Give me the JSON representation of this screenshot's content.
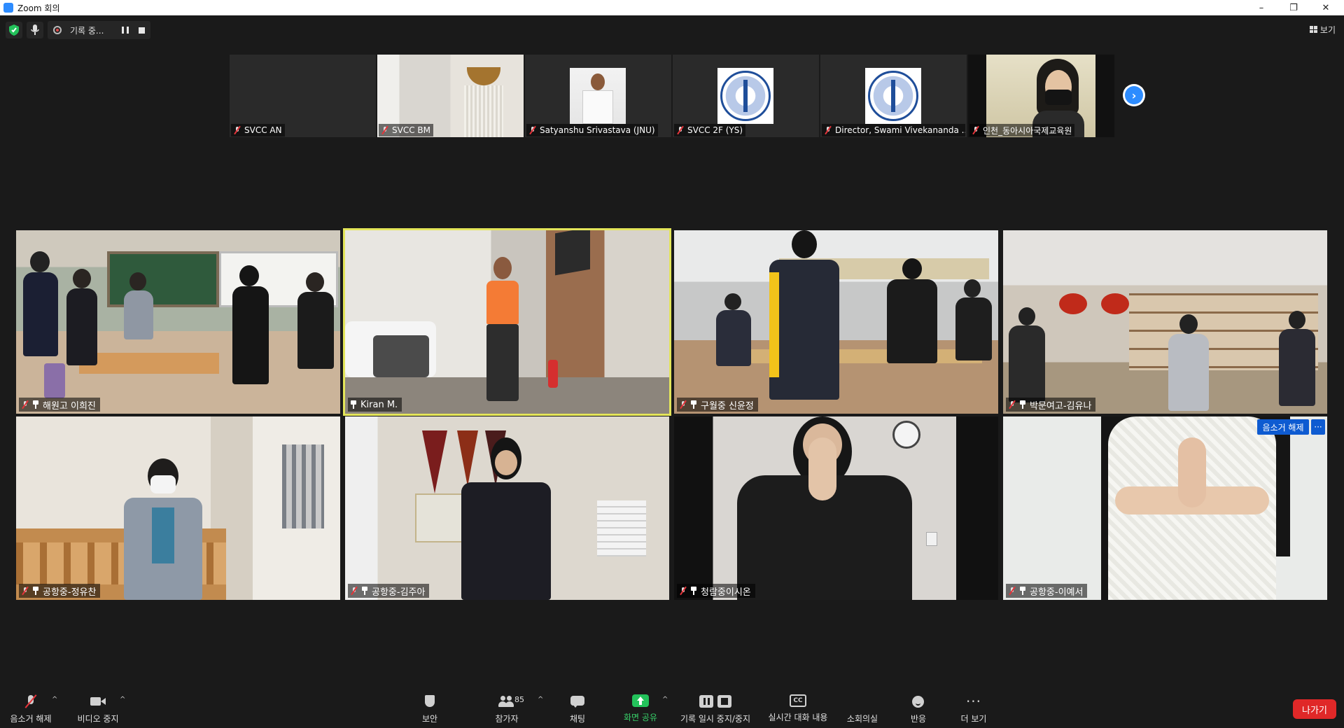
{
  "window": {
    "title": "Zoom 회의",
    "controls": {
      "minimize": "–",
      "maximize": "❐",
      "close": "✕"
    }
  },
  "status": {
    "recording_label": "기록 중...",
    "view_label": "보기"
  },
  "strip": [
    {
      "name": "SVCC AN",
      "kind": "blank"
    },
    {
      "name": "SVCC BM",
      "kind": "room"
    },
    {
      "name": "Satyanshu Srivastava (JNU)",
      "kind": "photo"
    },
    {
      "name": "SVCC 2F (YS)",
      "kind": "emblem"
    },
    {
      "name": "Director, Swami Vivekananda ...",
      "kind": "emblem"
    },
    {
      "name": "인천_동아시아국제교육원",
      "kind": "woman"
    }
  ],
  "tiles": [
    {
      "name": "해원고 이희진",
      "active": false
    },
    {
      "name": "Kiran M.",
      "active": true
    },
    {
      "name": "구월중 신윤정",
      "active": false
    },
    {
      "name": "박문여고-김유나",
      "active": false
    },
    {
      "name": "공항중-정유찬",
      "active": false
    },
    {
      "name": "공항중-김주아",
      "active": false
    },
    {
      "name": "청람중이시온",
      "active": false
    },
    {
      "name": "공항중-이예서",
      "active": false,
      "unmute_label": "음소거 해제",
      "more_label": "···"
    }
  ],
  "toolbar": {
    "unmute": "음소거 해제",
    "stop_video": "비디오 중지",
    "security": "보안",
    "participants": "참가자",
    "participants_count": "85",
    "chat": "채팅",
    "share_screen": "화면 공유",
    "pause_stop_recording": "기록 일시 중지/중지",
    "live_transcript": "실시간 대화 내용",
    "breakout_rooms": "소회의실",
    "reactions": "반응",
    "more": "더 보기",
    "leave": "나가기",
    "cc_text": "CC"
  },
  "colors": {
    "accent": "#2d8cff",
    "active_speaker": "#e3e55a",
    "leave": "#e02828",
    "share": "#23c25b",
    "muted": "#e5343a"
  },
  "icons": [
    "security-shield-icon",
    "mic-icon",
    "record-icon",
    "pause-icon",
    "stop-icon",
    "grid-icon",
    "next-page-icon",
    "muted-mic-icon",
    "pin-icon",
    "video-icon",
    "participants-icon",
    "chat-icon",
    "share-screen-icon",
    "cc-icon",
    "breakout-rooms-icon",
    "reactions-icon",
    "more-icon"
  ]
}
